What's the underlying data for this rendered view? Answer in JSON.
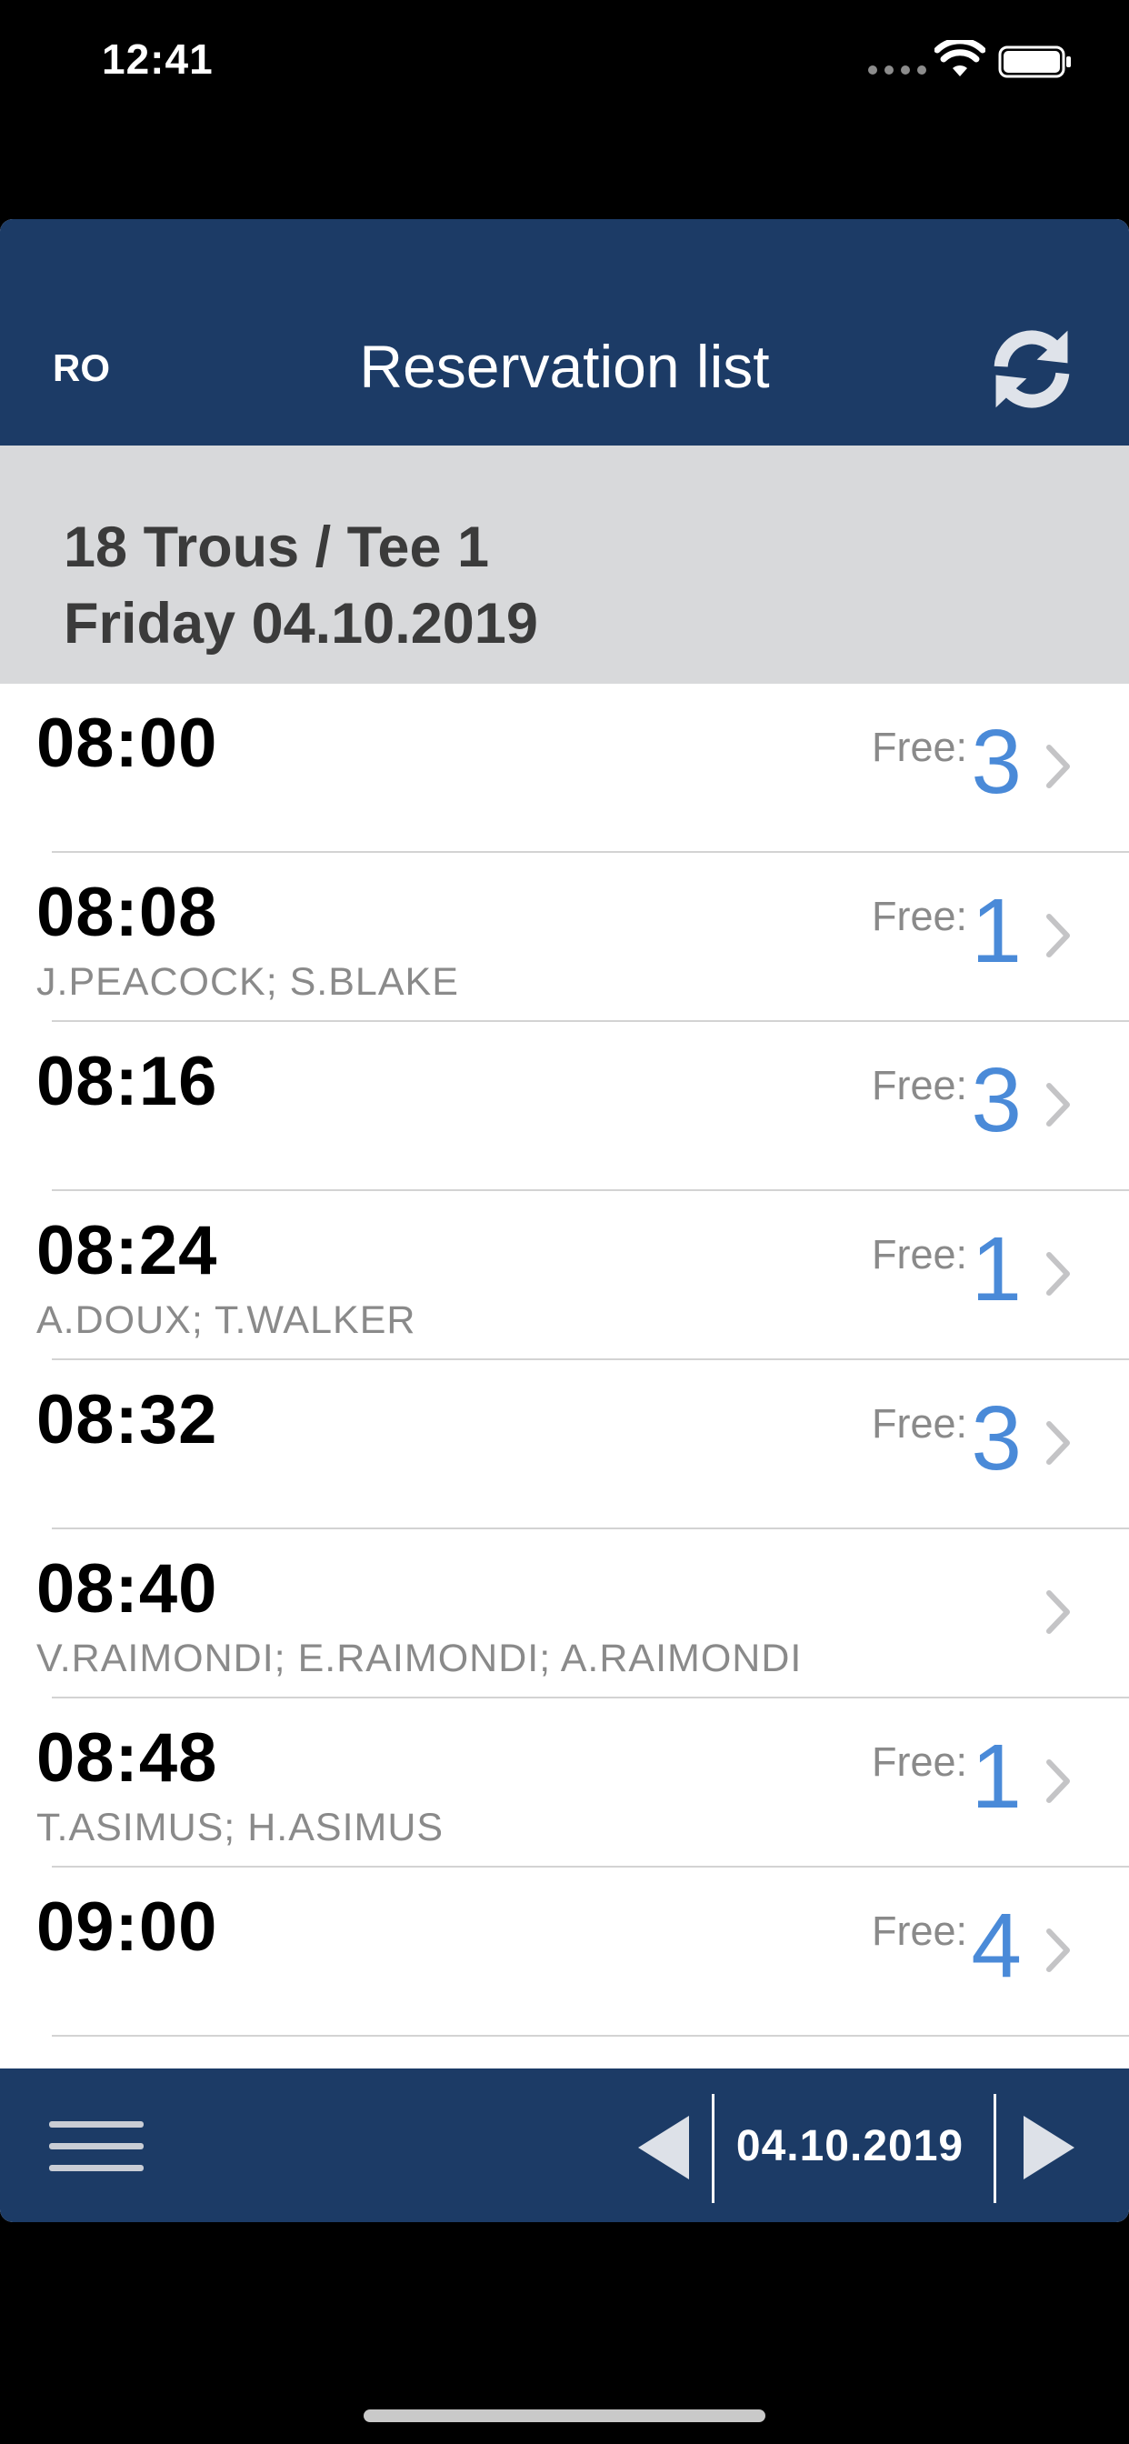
{
  "status": {
    "time": "12:41"
  },
  "nav": {
    "left_label": "RO",
    "title": "Reservation list"
  },
  "section": {
    "course": "18 Trous / Tee 1",
    "date_line": "Friday 04.10.2019"
  },
  "free_label": "Free:",
  "rows": [
    {
      "time": "08:00",
      "names": "",
      "free": "3"
    },
    {
      "time": "08:08",
      "names": "J.PEACOCK; S.BLAKE",
      "free": "1"
    },
    {
      "time": "08:16",
      "names": "",
      "free": "3"
    },
    {
      "time": "08:24",
      "names": "A.DOUX; T.WALKER",
      "free": "1"
    },
    {
      "time": "08:32",
      "names": "",
      "free": "3"
    },
    {
      "time": "08:40",
      "names": "V.RAIMONDI; E.RAIMONDI; A.RAIMONDI",
      "free": ""
    },
    {
      "time": "08:48",
      "names": "T.ASIMUS; H.ASIMUS",
      "free": "1"
    },
    {
      "time": "09:00",
      "names": "",
      "free": "4"
    }
  ],
  "toolbar": {
    "date": "04.10.2019"
  },
  "colors": {
    "nav": "#1c3b66",
    "accent": "#4a8ad8",
    "header_bg": "#d8d9db"
  }
}
